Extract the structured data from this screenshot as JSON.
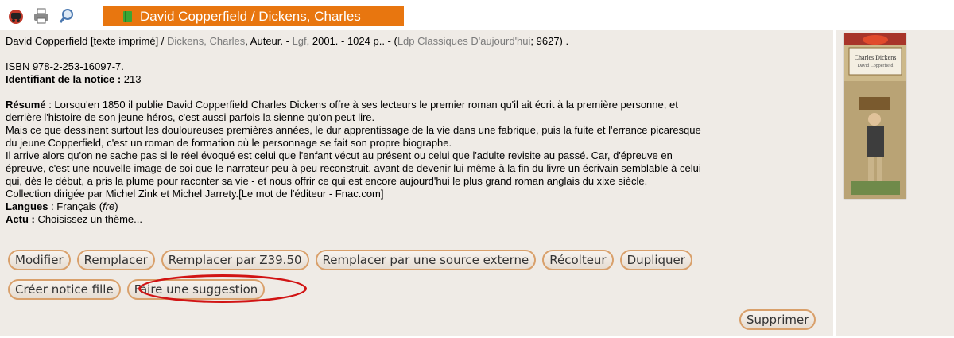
{
  "toolbar": {
    "icons": [
      "basket-icon",
      "print-icon",
      "search-icon"
    ],
    "title": "David Copperfield / Dickens, Charles"
  },
  "record": {
    "title_line": "David Copperfield [texte imprimé] / ",
    "author_link": "Dickens, Charles",
    "author_role": ", Auteur. - ",
    "publisher_link": "Lgf",
    "pub_details": ", 2001. - 1024 p.. - (",
    "series_link": "Ldp Classiques D'aujourd'hui",
    "series_number": "; 9627) .",
    "isbn": "ISBN 978-2-253-16097-7.",
    "notice_id_label": "Identifiant de la notice :",
    "notice_id_value": " 213",
    "summary_label": "Résumé",
    "summary_lines": [
      " : Lorsqu'en 1850 il publie David Copperfield Charles Dickens offre à ses lecteurs le premier roman qu'il ait écrit à la première personne, et",
      "derrière l'histoire de son jeune héros, c'est aussi parfois la sienne qu'on peut lire.",
      "Mais ce que dessinent surtout les douloureuses premières années, le dur apprentissage de la vie dans une fabrique, puis la fuite et l'errance picaresque",
      "du jeune Copperfield, c'est un roman de formation où le personnage se fait son propre biographe.",
      "Il arrive alors qu'on ne sache pas si le réel évoqué est celui que l'enfant vécut au présent ou celui que l'adulte revisite au passé. Car, d'épreuve en",
      "épreuve, c'est une nouvelle image de soi que le narrateur peu à peu reconstruit, avant de devenir lui-même à la fin du livre un écrivain semblable à celui",
      "qui, dès le début, a pris la plume pour raconter sa vie - et nous offrir ce qui est encore aujourd'hui le plus grand roman anglais du xixe siècle.",
      "Collection dirigée par Michel Zink et Michel Jarrety.[Le mot de l'éditeur - Fnac.com]"
    ],
    "languages_label": "Langues",
    "languages_value": " : Français (",
    "languages_code": "fre",
    "languages_close": ")",
    "actu_label": "Actu :",
    "actu_value": " Choisissez un thème..."
  },
  "actions": {
    "row1": [
      "Modifier",
      "Remplacer",
      "Remplacer par Z39.50",
      "Remplacer par une source externe",
      "Récolteur",
      "Dupliquer"
    ],
    "row2": [
      "Créer notice fille",
      "Faire une suggestion"
    ],
    "delete": "Supprimer"
  },
  "cover": {
    "author": "Charles Dickens",
    "title": "David Copperfield"
  },
  "colors": {
    "tab": "#e8760f",
    "panel": "#efebe6",
    "button_border": "#d9a06b",
    "highlight": "#d11414"
  }
}
